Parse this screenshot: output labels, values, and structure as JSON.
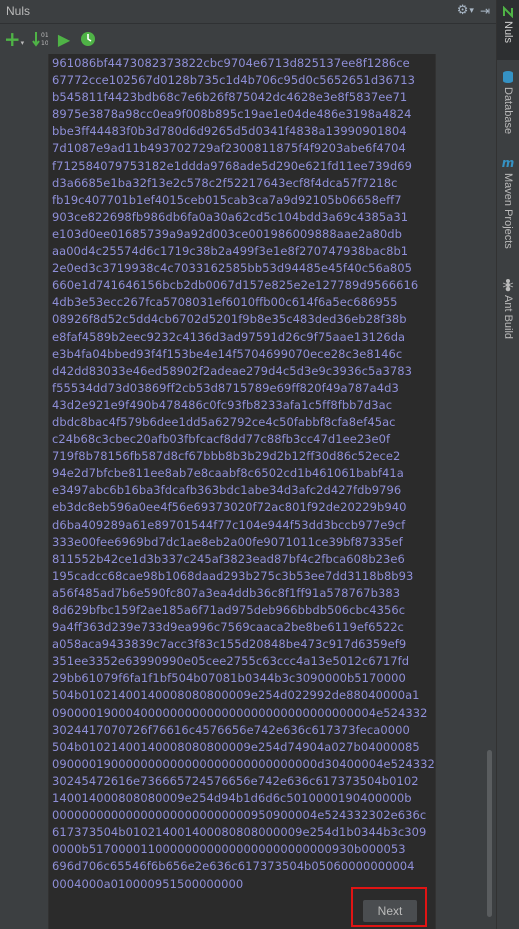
{
  "panel": {
    "title": "Nuls"
  },
  "title_actions": {
    "settings_glyph": "⚙",
    "dropdown_glyph": "▾",
    "hide_glyph": "⇥"
  },
  "toolbar": {
    "add_glyph": "+",
    "run_glyph": "▶"
  },
  "content": {
    "hex_lines": [
      "961086bf4473082373822cbc9704e6713d825137ee8f1286ce",
      "67772cce102567d0128b735c1d4b706c95d0c5652651d36713",
      "b545811f4423bdb68c7e6b26f875042dc4628e3e8f5837ee71",
      "8975e3878a98cc0ea9f008b895c19ae1e04de486e3198a4824",
      "bbe3ff44483f0b3d780d6d9265d5d0341f4838a13990901804",
      "7d1087e9ad11b493702729af2300811875f4f9203abe6f4704",
      "f712584079753182e1ddda9768ade5d290e621fd11ee739d69",
      "d3a6685e1ba32f13e2c578c2f52217643ecf8f4dca57f7218c",
      "fb19c407701b1ef4015ceb015cab3ca7a9d92105b06658eff7",
      "903ce822698fb986db6fa0a30a62cd5c104bdd3a69c4385a31",
      "e103d0ee01685739a9a92d003ce001986009888aae2a80db",
      "aa00d4c25574d6c1719c38b2a499f3e1e8f270747938bac8b1",
      "2e0ed3c3719938c4c7033162585bb53d94485e45f40c56a805",
      "660e1d741646156bcb2db0067d157e825e2e127789d9566616",
      "4db3e53ecc267fca5708031ef6010ffb00c614f6a5ec686955",
      "08926f8d52c5dd4cb6702d5201f9b8e35c483ded36eb28f38b",
      "e8faf4589b2eec9232c4136d3ad97591d26c9f75aae13126da",
      "e3b4fa04bbed93f4f153be4e14f5704699070ece28c3e8146c",
      "d42dd83033e46ed58902f2adeae279d4c5d3e9c3936c5a3783",
      "f55534dd73d03869ff2cb53d8715789e69ff820f49a787a4d3",
      "43d2e921e9f490b478486c0fc93fb8233afa1c5ff8fbb7d3ac",
      "dbdc8bac4f579b6dee1dd5a62792ce4c50fabbf8cfa8ef45ac",
      "c24b68c3cbec20afb03fbfcacf8dd77c88fb3cc47d1ee23e0f",
      "719f8b78156fb587d8cf67bbb8b3b29d2b12ff30d86c52ece2",
      "94e2d7bfcbe811ee8ab7e8caabf8c6502cd1b461061babf41a",
      "e3497abc6b16ba3fdcafb363bdc1abe34d3afc2d427fdb9796",
      "eb3dc8eb596a0ee4f56e69373020f72ac801f92de20229b940",
      "d6ba409289a61e89701544f77c104e944f53dd3bccb977e9cf",
      "333e00fee6969bd7dc1ae8eb2a00fe9071011ce39bf87335ef",
      "811552b42ce1d3b337c245af3823ead87bf4c2fbca608b23e6",
      "195cadcc68cae98b1068daad293b275c3b53ee7dd3118b8b93",
      "a56f485ad7b6e590fc807a3ea4ddb36c8f1ff91a578767b383",
      "8d629bfbc159f2ae185a6f71ad975deb966bbdb506cbc4356c",
      "9a4ff363d239e733d9ea996c7569caaca2be8be6119ef6522c",
      "a058aca9433839c7acc3f83c155d20848be473c917d6359ef9",
      "351ee3352e63990990e05cee2755c63ccc4a13e5012c6717fd",
      "29bb61079f6fa1f1bf504b07081b0344b3c3090000b5170000",
      "504b01021400140008080800009e254d022992de88040000a1",
      "09000019000400000000000000000000000000000004e524332",
      "3024417070726f76616c4576656e742e636c617373feca0000",
      "504b01021400140008080800009e254d74904a027b04000085",
      "090000190000000000000000000000000000d30400004e524332",
      "30245472616e736665724576656e742e636c617373504b0102",
      "140014000808080009e254d94b1d6d6c5010000190400000b",
      "000000000000000000000000000950900004e524332302e636c",
      "617373504b010214001400080808000009e254d1b0344b3c309",
      "0000b517000011000000000000000000000000930b000053",
      "696d706c65546f6b656e2e636c617373504b05060000000004",
      "0004000a010000951500000000"
    ]
  },
  "next_button": {
    "label": "Next"
  },
  "side_tabs": [
    {
      "label": "Nuls",
      "icon": "nuls-icon",
      "active": true
    },
    {
      "label": "Database",
      "icon": "database-icon",
      "active": false
    },
    {
      "label": "Maven Projects",
      "icon": "maven-icon",
      "active": false
    },
    {
      "label": "Ant Build",
      "icon": "ant-icon",
      "active": false
    }
  ],
  "colors": {
    "hex_text": "#8f8fd8",
    "highlight": "#e01414",
    "accent_green": "#4fb346",
    "accent_blue": "#3592c4"
  }
}
